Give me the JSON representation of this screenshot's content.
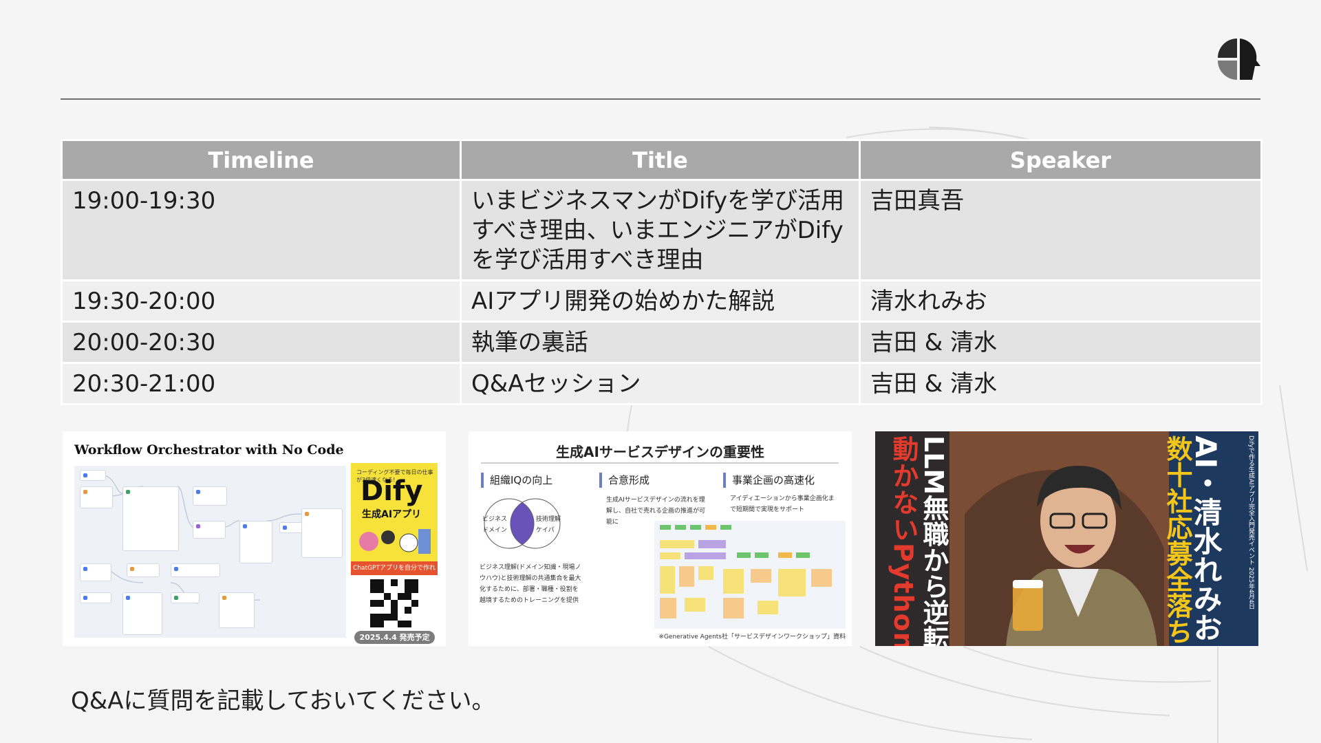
{
  "logo_icon": "brand-logo-icon",
  "agenda": {
    "headers": [
      "Timeline",
      "Title",
      "Speaker"
    ],
    "rows": [
      {
        "time": "19:00-19:30",
        "title": "いまビジネスマンがDifyを学び活用すべき理由、いまエンジニアがDifyを学び活用すべき理由",
        "speaker": "吉田真吾"
      },
      {
        "time": "19:30-20:00",
        "title": "AIアプリ開発の始めかた解説",
        "speaker": "清水れみお"
      },
      {
        "time": "20:00-20:30",
        "title": "執筆の裏話",
        "speaker": "吉田 & 清水"
      },
      {
        "time": "20:30-21:00",
        "title": "Q&Aセッション",
        "speaker": "吉田 & 清水"
      }
    ]
  },
  "thumb_book": {
    "title": "Workflow Orchestrator with No Code",
    "book_top": "コーディング不要で毎日の仕事が3倍速くなる!",
    "book_brand": "Dify",
    "book_subtitle": "生成AIアプリ",
    "book_band": "ChatGPTアプリを自分で作れる!",
    "release": "2025.4.4 発売予定"
  },
  "thumb_service": {
    "title": "生成AIサービスデザインの重要性",
    "col1_heading": "組織IQの向上",
    "col2_heading": "合意形成",
    "col3_heading": "事業企画の高速化",
    "venn_left": "ビジネス ドメイン",
    "venn_right": "技術理解 ケイパ",
    "col1_text": "ビジネス理解(ドメイン知識・現場ノウハウ)と技術理解の共通集合を最大化するために、部署・職種・役割を越境するためのトレーニングを提供",
    "col2_text": "生成AIサービスデザインの流れを理解し、自社で売れる企画の推進が可能に",
    "col3_text": "アイディエーションから事業企画化まで短期間で実現をサポート",
    "footnote": "※Generative Agents社「サービスデザインワークショップ」資料"
  },
  "thumb_talk": {
    "left_red": "動かないPython...",
    "left_white": "LLM無職から逆転",
    "right_white": "AI・清水れみお",
    "right_yellow": "数十社応募全落ち",
    "right_tiny": "Difyで作る生成AIアプリ完全入門発売イベント 2025年4月4日"
  },
  "note": "Q&Aに質問を記載しておいてください。"
}
